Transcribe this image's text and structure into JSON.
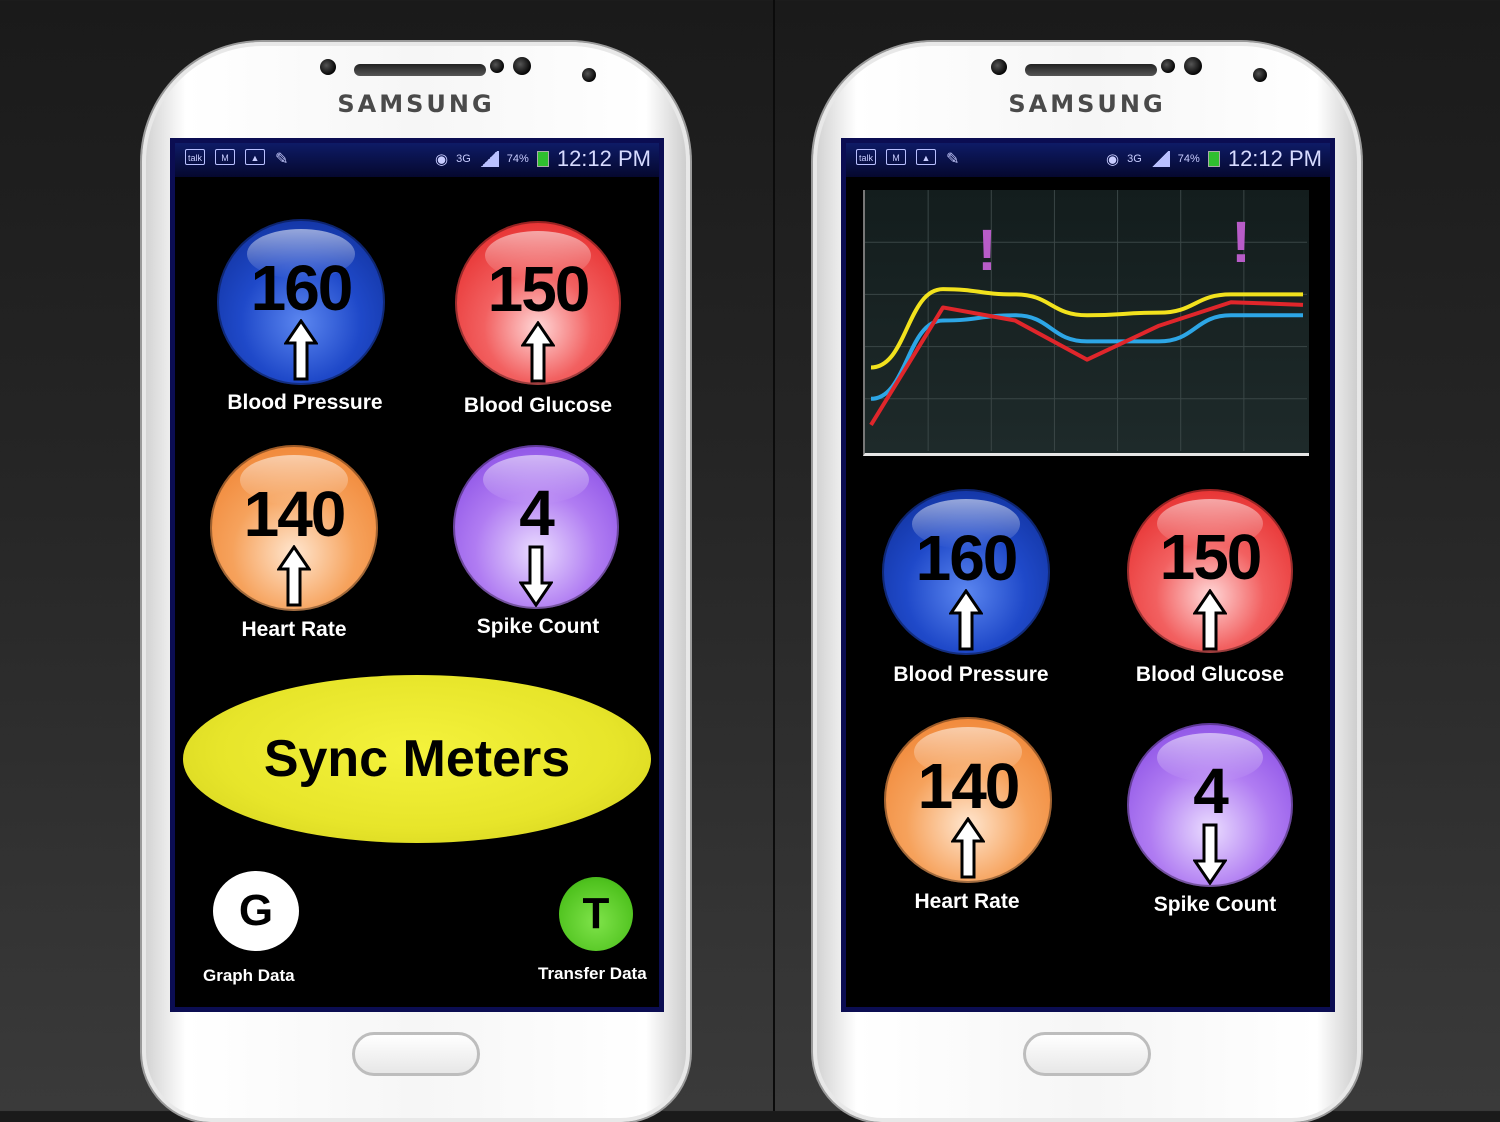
{
  "device": {
    "brand": "SAMSUNG"
  },
  "status_bar": {
    "icons": [
      "talk-icon",
      "gmail-icon",
      "gallery-icon",
      "pin-icon",
      "eye-icon"
    ],
    "talk_label": "talk",
    "network": "3G",
    "battery": "74%",
    "time": "12:12 PM"
  },
  "meters": {
    "blood_pressure": {
      "value": "160",
      "label": "Blood Pressure",
      "trend": "up",
      "color": "#1f49c9"
    },
    "blood_glucose": {
      "value": "150",
      "label": "Blood Glucose",
      "trend": "up",
      "color": "#e21c1c"
    },
    "heart_rate": {
      "value": "140",
      "label": "Heart Rate",
      "trend": "up",
      "color": "#ee7a26"
    },
    "spike_count": {
      "value": "4",
      "label": "Spike Count",
      "trend": "down",
      "color": "#7d3fe1"
    }
  },
  "left_screen": {
    "sync_label": "Sync Meters",
    "graph_button": {
      "letter": "G",
      "label": "Graph Data"
    },
    "transfer_button": {
      "letter": "T",
      "label": "Transfer Data"
    }
  },
  "right_screen": {
    "alert_marker": "!",
    "chart_data": {
      "type": "line",
      "grid": true,
      "series": [
        {
          "color": "#f2e21d",
          "values": [
            0.32,
            0.62,
            0.6,
            0.52,
            0.53,
            0.6,
            0.6
          ]
        },
        {
          "color": "#2da6e6",
          "values": [
            0.2,
            0.5,
            0.52,
            0.42,
            0.42,
            0.52,
            0.52
          ]
        },
        {
          "color": "#e0262b",
          "values": [
            0.1,
            0.55,
            0.5,
            0.35,
            0.48,
            0.57,
            0.56
          ]
        }
      ],
      "alerts": [
        {
          "position": "upper-left"
        },
        {
          "position": "upper-right"
        }
      ]
    }
  }
}
